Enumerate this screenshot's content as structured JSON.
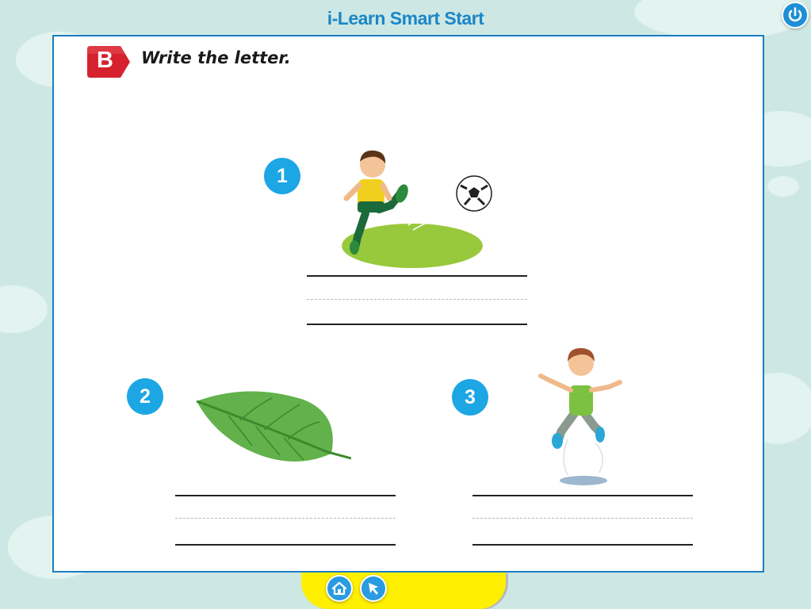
{
  "app": {
    "title": "i-Learn Smart Start"
  },
  "exercise": {
    "section_letter": "B",
    "instruction": "Write the letter.",
    "items": [
      {
        "number": "1",
        "picture": "boy-kicking-ball"
      },
      {
        "number": "2",
        "picture": "leaf"
      },
      {
        "number": "3",
        "picture": "boy-jumping"
      }
    ]
  },
  "toolbar": {
    "power_icon": "power-icon",
    "home_icon": "home-icon",
    "back_icon": "pointer-arrow-icon"
  },
  "colors": {
    "background": "#cde8e4",
    "title": "#1b86c6",
    "number_circle": "#1ca6e4",
    "badge": "#d6222e",
    "bottom_bar": "#ffef00"
  }
}
